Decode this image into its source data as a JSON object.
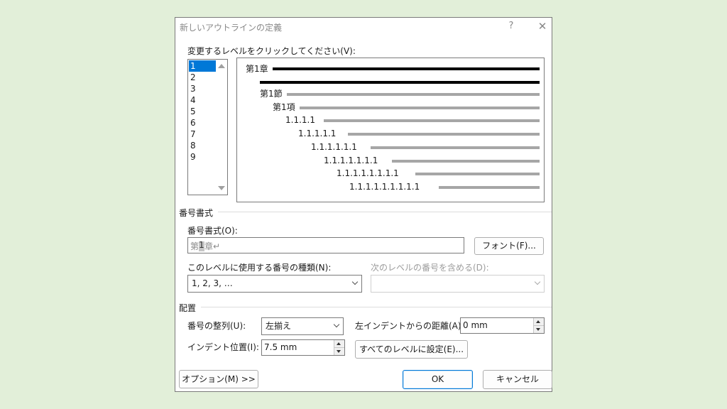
{
  "dialog": {
    "title": "新しいアウトラインの定義",
    "help_glyph": "?",
    "close_glyph": "✕"
  },
  "levels": {
    "prompt": "変更するレベルをクリックしてください(V):",
    "items": [
      "1",
      "2",
      "3",
      "4",
      "5",
      "6",
      "7",
      "8",
      "9"
    ],
    "selected": "1"
  },
  "preview": {
    "labels": [
      "第1章",
      "第1節",
      "第1項",
      "1.1.1.1",
      "1.1.1.1.1",
      "1.1.1.1.1.1",
      "1.1.1.1.1.1.1",
      "1.1.1.1.1.1.1.1",
      "1.1.1.1.1.1.1.1.1"
    ],
    "highlight_color": "#000000",
    "other_color": "#a6a6a6"
  },
  "number_format": {
    "section_title": "番号書式",
    "format_label": "番号書式(O):",
    "format_prefix": "第",
    "format_number": "1",
    "format_suffix": "章↵",
    "font_button": "フォント(F)...",
    "style_label": "このレベルに使用する番号の種類(N):",
    "style_value": "1, 2, 3, …",
    "include_label": "次のレベルの番号を含める(D):",
    "include_value": ""
  },
  "position": {
    "section_title": "配置",
    "alignment_label": "番号の整列(U):",
    "alignment_value": "左揃え",
    "left_indent_label": "左インデントからの距離(A):",
    "left_indent_value": "0 mm",
    "indent_label": "インデント位置(I):",
    "indent_value": "7.5 mm",
    "set_all_button": "すべてのレベルに設定(E)..."
  },
  "footer": {
    "options_button": "オプション(M) >>",
    "ok_button": "OK",
    "cancel_button": "キャンセル"
  },
  "colors": {
    "background": "#e2efd9",
    "accent": "#0078d7"
  }
}
